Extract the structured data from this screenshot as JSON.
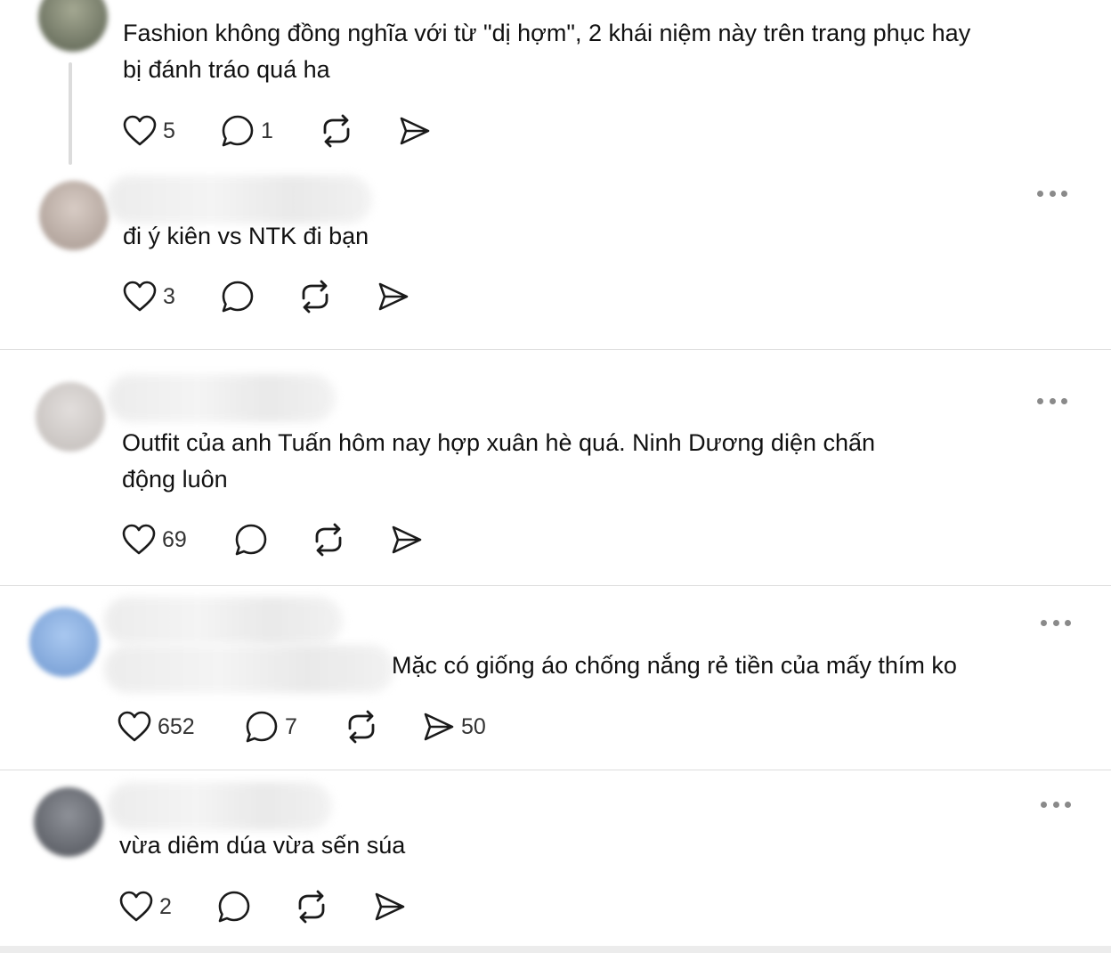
{
  "posts": [
    {
      "text_lines": [
        "Fashion không đồng nghĩa với từ \"dị hợm\", 2 khái niệm này trên trang phục hay",
        "bị đánh tráo quá ha"
      ],
      "likes": "5",
      "replies": "1",
      "reposts": "",
      "shares": ""
    },
    {
      "text_lines": [
        "đi ý kiên vs NTK đi bạn"
      ],
      "likes": "3",
      "replies": "",
      "reposts": "",
      "shares": ""
    },
    {
      "text_lines": [
        "Outfit của anh Tuấn hôm nay hợp xuân hè quá. Ninh Dương diện chấn",
        "động luôn"
      ],
      "likes": "69",
      "replies": "",
      "reposts": "",
      "shares": ""
    },
    {
      "text_lines": [
        "Mặc có giống áo chống nắng rẻ tiền của mấy thím ko"
      ],
      "likes": "652",
      "replies": "7",
      "reposts": "",
      "shares": "50"
    },
    {
      "text_lines": [
        "vừa diêm dúa vừa sến súa"
      ],
      "likes": "2",
      "replies": "",
      "reposts": "",
      "shares": ""
    }
  ],
  "icons": {
    "like": "heart-icon",
    "reply": "comment-icon",
    "repost": "repost-icon",
    "share": "send-icon",
    "more": "more-options-icon"
  },
  "colors": {
    "icon": "#1a1a1a",
    "divider": "#dddddd",
    "avatar_1": "#8a8f7a",
    "avatar_2": "#c8bcb6",
    "avatar_3": "#d6d2d0",
    "avatar_4": "#8fb4e6",
    "avatar_5": "#7c7f86"
  }
}
